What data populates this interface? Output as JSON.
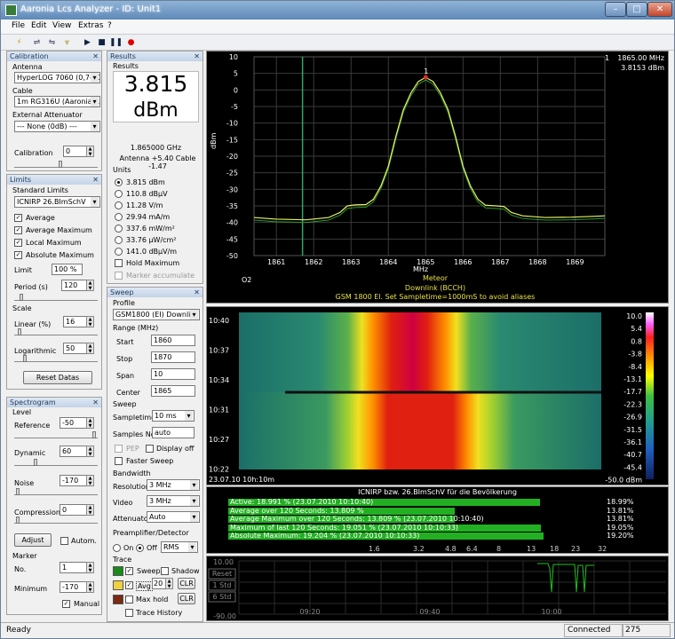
{
  "window": {
    "title": "Aaronia Lcs Analyzer - ID: Unit1"
  },
  "menu": [
    "File",
    "Edit",
    "View",
    "Extras",
    "?"
  ],
  "calibration": {
    "title": "Calibration",
    "antenna_label": "Antenna",
    "antenna": "HyperLOG 7060 (0,7-6G",
    "cable_label": "Cable",
    "cable": "1m RG316U (Aaronia A",
    "attenuator_label": "External Attenuator",
    "attenuator": "--- None (0dB) ---",
    "calib_label": "Calibration",
    "calib_value": "0"
  },
  "limits": {
    "title": "Limits",
    "std_label": "Standard Limits",
    "std": "ICNIRP 26.BImSchV",
    "checks": [
      {
        "label": "Average",
        "checked": true
      },
      {
        "label": "Average Maximum",
        "checked": true
      },
      {
        "label": "Local Maximum",
        "checked": true
      },
      {
        "label": "Absolute Maximum",
        "checked": true
      }
    ],
    "limit_label": "Limit",
    "limit_value": "100 %",
    "period_label": "Period (s)",
    "period_value": "120",
    "scale_label": "Scale",
    "linear_label": "Linear (%)",
    "linear_value": "16",
    "log_label": "Logarithmic",
    "log_value": "50",
    "reset_label": "Reset Datas"
  },
  "spectrogram": {
    "title": "Spectrogram",
    "level_label": "Level",
    "reference_label": "Reference",
    "reference_value": "-50",
    "dynamic_label": "Dynamic",
    "dynamic_value": "60",
    "noise_label": "Noise",
    "noise_value": "-170",
    "compression_label": "Compression",
    "compression_value": "0",
    "adjust_label": "Adjust",
    "autom_label": "Autom.",
    "marker_label": "Marker",
    "no_label": "No.",
    "no_value": "1",
    "minimum_label": "Minimum",
    "minimum_value": "-170",
    "manual_label": "Manual"
  },
  "results": {
    "title": "Results",
    "group": "Results",
    "value": "3.815",
    "unit": "dBm",
    "freq": "1.865000 GHz",
    "antenna": "Antenna +5.40 Cable -1.47",
    "units_label": "Units",
    "units": [
      {
        "label": "3.815 dBm",
        "on": true
      },
      {
        "label": "110.8 dBµV",
        "on": false
      },
      {
        "label": "11.28 V/m",
        "on": false
      },
      {
        "label": "29.94 mA/m",
        "on": false
      },
      {
        "label": "337.6 mW/m²",
        "on": false
      },
      {
        "label": "33.76 µW/cm²",
        "on": false
      },
      {
        "label": "141.0 dBµV/m",
        "on": false
      }
    ],
    "hold_max": "Hold Maximum",
    "marker_acc": "Marker accumulate"
  },
  "sweep": {
    "title": "Sweep",
    "profile_label": "Profile",
    "profile": "GSM1800 (EI) Downlin",
    "range_label": "Range (MHz)",
    "start_label": "Start",
    "start": "1860",
    "stop_label": "Stop",
    "stop": "1870",
    "span_label": "Span",
    "span": "10",
    "center_label": "Center",
    "center": "1865",
    "sweep_label": "Sweep",
    "sampletime_label": "Sampletime",
    "sampletime": "10 ms",
    "samples_label": "Samples No",
    "samples": "auto",
    "pep_label": "PEP",
    "display_off_label": "Display off",
    "faster_label": "Faster Sweep",
    "bandwidth_label": "Bandwidth",
    "resolution_label": "Resolution",
    "resolution": "3 MHz",
    "video_label": "Video",
    "video": "3 MHz",
    "attenuator_label": "Attenuator",
    "attenuator": "Auto",
    "preamp_label": "Preamplifier/Detector",
    "on_label": "On",
    "off_label": "Off",
    "detector": "RMS",
    "trace_label": "Trace",
    "sweep_trace": "Sweep",
    "shadow": "Shadow",
    "avg": "Avg",
    "avg_value": "20",
    "clr": "CLR",
    "max_hold": "Max hold",
    "trace_history": "Trace History"
  },
  "spectrum": {
    "top_right_freq": "1865.00 MHz",
    "top_right_level": "3.8153 dBm",
    "marker_no": "1",
    "peak_label": "1",
    "y_ticks": [
      "10",
      "5",
      "0",
      "-5",
      "-10",
      "-15",
      "-20",
      "-25",
      "-30",
      "-35",
      "-40",
      "-45",
      "-50"
    ],
    "x_ticks": [
      "1861",
      "1862",
      "1863",
      "1864",
      "1865",
      "1866",
      "1867",
      "1868",
      "1869"
    ],
    "ylabel": "dBm",
    "xlabel": "MHz",
    "o2": "O2",
    "meteor": "Meteor",
    "downlink": "Downlink (BCCH)",
    "note": "GSM 1800 El. Set Sampletime=1000mS to avoid aliases",
    "ref_line_mhz": 1861.7,
    "trace_color": "#e8f060"
  },
  "waterfall": {
    "times": [
      "10:40",
      "10:37",
      "10:34",
      "10:31",
      "10:27",
      "10:22"
    ],
    "bottom_left": "23.07.10 10h:10m",
    "scale": [
      "10.0",
      "5.4",
      "0.8",
      "-3.8",
      "-8.4",
      "-13.1",
      "-17.7",
      "-22.3",
      "-26.9",
      "-31.5",
      "-36.1",
      "-40.7",
      "-45.4",
      "-50.0 dBm"
    ]
  },
  "icnirp": {
    "title": "ICNIRP bzw. 26.BImSchV für die Bevölkerung",
    "bars": [
      {
        "label": "Active: 18.991 % (23.07.2010 10:10:40)",
        "value": "18.99%",
        "pct": 18.99
      },
      {
        "label": "Average over 120 Seconds: 13.809 %",
        "value": "13.81%",
        "pct": 13.81
      },
      {
        "label": "Average Maximum over 120 Seconds: 13.809 % (23.07.2010 10:10:40)",
        "value": "13.81%",
        "pct": 13.81
      },
      {
        "label": "Maximum of last 120 Seconds: 19.051 % (23.07.2010 10:10:33)",
        "value": "19.05%",
        "pct": 19.05
      },
      {
        "label": "Absolute Maximum: 19.204 % (23.07.2010 10:10:33)",
        "value": "19.20%",
        "pct": 19.2
      }
    ],
    "scale": [
      "1.6",
      "3.2",
      "4.8",
      "6.4",
      "8",
      "13",
      "18",
      "23",
      "32"
    ]
  },
  "history": {
    "top": "10.00",
    "bottom": "-90.00",
    "buttons": [
      "Reset",
      "1 Std",
      "6 Std"
    ],
    "times": [
      "09:20",
      "09:40",
      "10:00"
    ]
  },
  "status": {
    "left": "Ready",
    "connected": "Connected",
    "num": "275"
  }
}
